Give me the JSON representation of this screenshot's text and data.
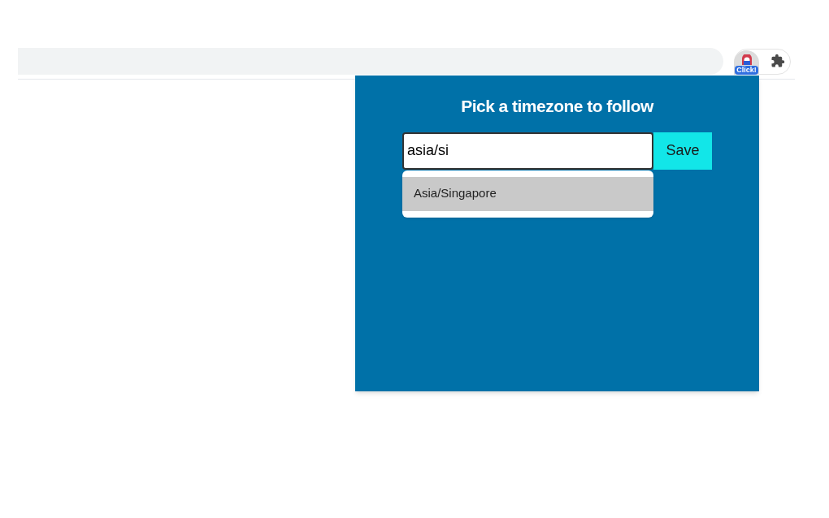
{
  "toolbar": {
    "extension_badge": "Click!"
  },
  "popup": {
    "title": "Pick a timezone to follow",
    "search": {
      "value": "asia/si"
    },
    "save_button": "Save",
    "suggestions": [
      {
        "label": "Asia/Singapore",
        "selected": true
      }
    ]
  }
}
